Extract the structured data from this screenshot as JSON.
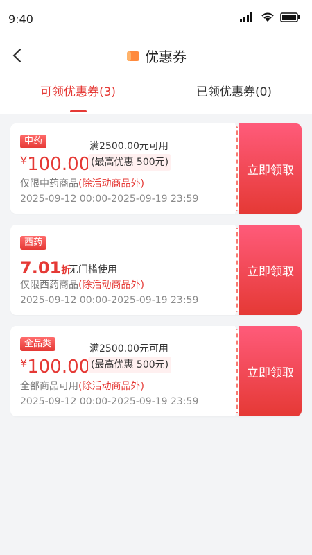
{
  "status": {
    "time": "9:40"
  },
  "nav": {
    "title": "优惠券",
    "icon": "coupon-icon"
  },
  "tabs": [
    {
      "label": "可领优惠券(3)",
      "active": true
    },
    {
      "label": "已领优惠券(0)",
      "active": false
    }
  ],
  "coupons": [
    {
      "tag": "中药",
      "condition": "满2500.00元可用",
      "currency": "¥",
      "amount": "100.00",
      "cap": "(最高优惠 500元)",
      "scope": "仅限中药商品",
      "exception": "(除活动商品外)",
      "date": "2025-09-12 00:00-2025-09-19 23:59",
      "action": "立即领取"
    },
    {
      "tag": "西药",
      "discount": "7.01",
      "discount_unit": "折",
      "note": "无门槛使用",
      "scope": "仅限西药商品",
      "exception": "(除活动商品外)",
      "date": "2025-09-12 00:00-2025-09-19 23:59",
      "action": "立即领取"
    },
    {
      "tag": "全品类",
      "condition": "满2500.00元可用",
      "currency": "¥",
      "amount": "100.00",
      "cap": "(最高优惠 500元)",
      "scope": "全部商品可用",
      "exception": "(除活动商品外)",
      "date": "2025-09-12 00:00-2025-09-19 23:59",
      "action": "立即领取"
    }
  ],
  "colors": {
    "accent": "#e53935",
    "accent_light": "#ff5b7a",
    "background": "#f3f4f6"
  }
}
